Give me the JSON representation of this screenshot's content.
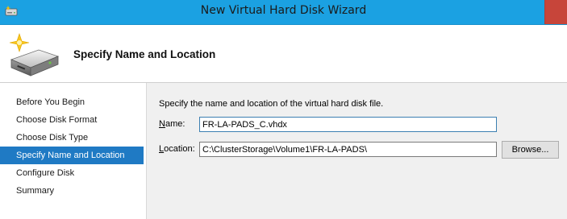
{
  "window": {
    "title": "New Virtual Hard Disk Wizard"
  },
  "header": {
    "title": "Specify Name and Location",
    "icon": "hard-disk-new-icon"
  },
  "nav": {
    "items": [
      {
        "label": "Before You Begin",
        "selected": false
      },
      {
        "label": "Choose Disk Format",
        "selected": false
      },
      {
        "label": "Choose Disk Type",
        "selected": false
      },
      {
        "label": "Specify Name and Location",
        "selected": true
      },
      {
        "label": "Configure Disk",
        "selected": false
      },
      {
        "label": "Summary",
        "selected": false
      }
    ]
  },
  "form": {
    "instruction": "Specify the name and location of the virtual hard disk file.",
    "name_label_hotkey": "N",
    "name_label_rest": "ame:",
    "name_value": "FR-LA-PADS_C.vhdx",
    "location_label_hotkey": "L",
    "location_label_rest": "ocation:",
    "location_value": "C:\\ClusterStorage\\Volume1\\FR-LA-PADS\\",
    "browse_label": "Browse..."
  },
  "colors": {
    "titlebar": "#1ba1e2",
    "close_button": "#c7453a",
    "nav_selected": "#1f7ac4"
  }
}
